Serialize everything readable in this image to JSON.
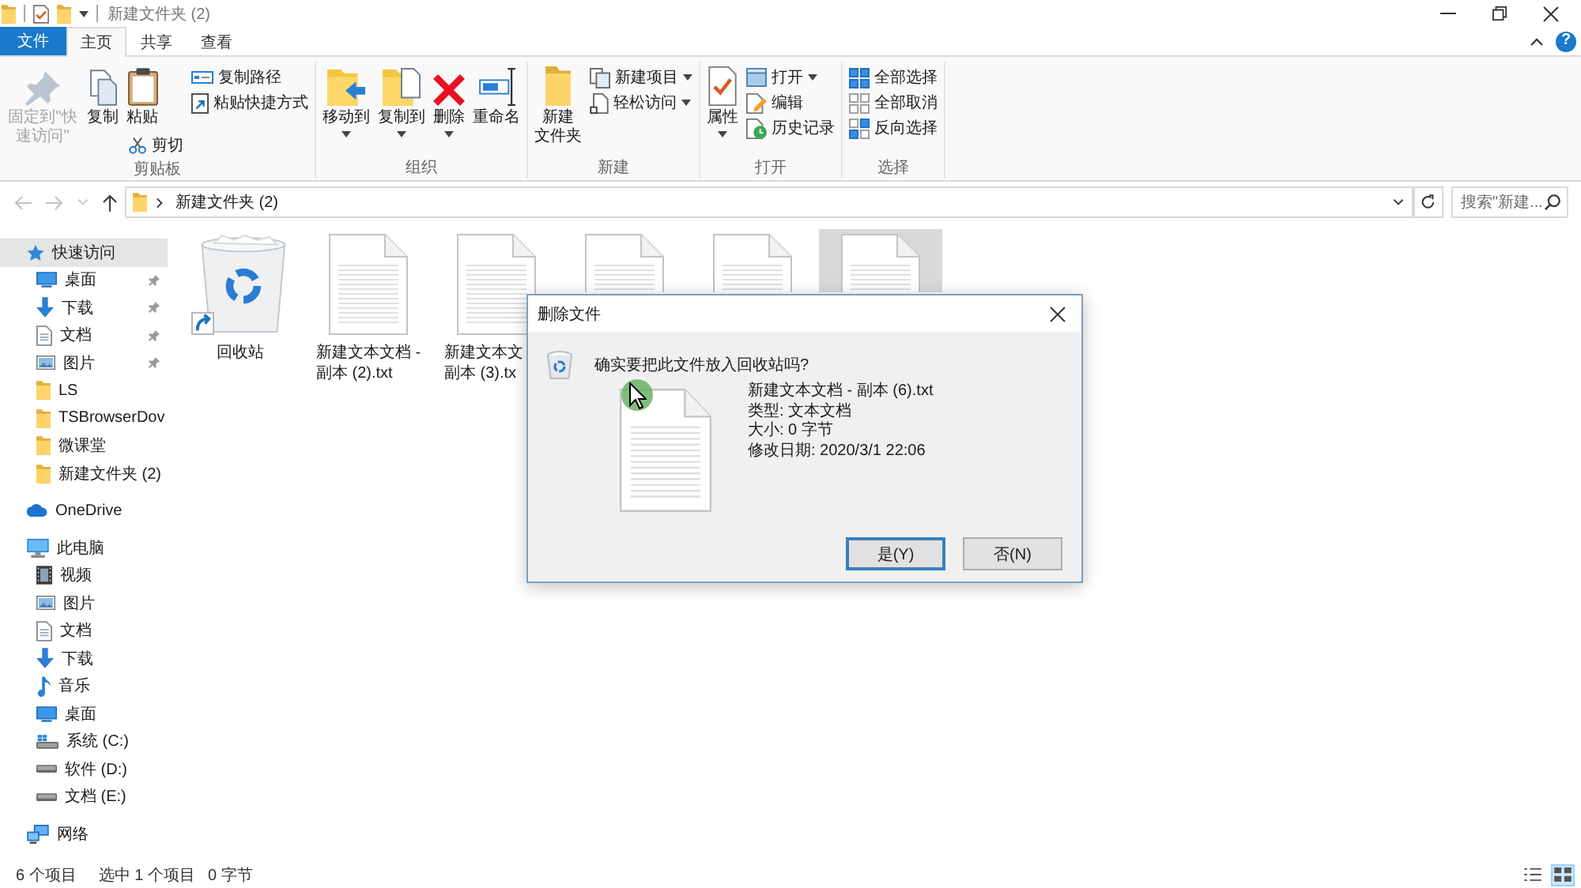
{
  "title_bar": {
    "title": "新建文件夹 (2)"
  },
  "tabs": [
    {
      "label": "文件",
      "kind": "menu",
      "selected": false
    },
    {
      "label": "主页",
      "kind": "tab",
      "selected": true
    },
    {
      "label": "共享",
      "kind": "tab",
      "selected": false
    },
    {
      "label": "查看",
      "kind": "tab",
      "selected": false
    }
  ],
  "help_button": "?",
  "ribbon": {
    "groups": [
      {
        "label": "剪贴板",
        "columns": [
          {
            "items": [
              {
                "kind": "large",
                "label": "固定到\"快速访问\"",
                "dropdown": false,
                "disabled": true
              }
            ]
          },
          {
            "items": [
              {
                "kind": "large",
                "label": "复制",
                "dropdown": false,
                "disabled": false
              }
            ]
          },
          {
            "items": [
              {
                "kind": "large",
                "label": "粘贴",
                "dropdown": false,
                "disabled": false
              },
              {
                "kind": "small",
                "label": "剪切",
                "dropdown": false,
                "disabled": false
              }
            ]
          },
          {
            "items": [
              {
                "kind": "small",
                "label": "复制路径",
                "dropdown": false,
                "disabled": false
              },
              {
                "kind": "small",
                "label": "粘贴快捷方式",
                "dropdown": false,
                "disabled": false
              }
            ]
          }
        ]
      },
      {
        "label": "组织",
        "columns": [
          {
            "items": [
              {
                "kind": "large",
                "label": "移动到",
                "dropdown": true,
                "disabled": false
              }
            ]
          },
          {
            "items": [
              {
                "kind": "large",
                "label": "复制到",
                "dropdown": true,
                "disabled": false
              }
            ]
          },
          {
            "items": [
              {
                "kind": "large",
                "label": "删除",
                "dropdown": true,
                "disabled": false
              }
            ]
          },
          {
            "items": [
              {
                "kind": "large",
                "label": "重命名",
                "dropdown": false,
                "disabled": false
              }
            ]
          }
        ]
      },
      {
        "label": "新建",
        "columns": [
          {
            "items": [
              {
                "kind": "large",
                "label_lines": [
                  "新建",
                  "文件夹"
                ],
                "dropdown": false,
                "disabled": false
              }
            ]
          },
          {
            "items": [
              {
                "kind": "small",
                "label": "新建项目",
                "dropdown": true,
                "disabled": false
              },
              {
                "kind": "small",
                "label": "轻松访问",
                "dropdown": true,
                "disabled": false
              }
            ]
          }
        ]
      },
      {
        "label": "打开",
        "columns": [
          {
            "items": [
              {
                "kind": "large",
                "label": "属性",
                "dropdown": true,
                "disabled": false
              }
            ]
          },
          {
            "items": [
              {
                "kind": "small",
                "label": "打开",
                "dropdown": true,
                "disabled": false
              },
              {
                "kind": "small",
                "label": "编辑",
                "dropdown": false,
                "disabled": false
              },
              {
                "kind": "small",
                "label": "历史记录",
                "dropdown": false,
                "disabled": false
              }
            ]
          }
        ]
      },
      {
        "label": "选择",
        "columns": [
          {
            "items": [
              {
                "kind": "small",
                "label": "全部选择",
                "dropdown": false,
                "disabled": false
              },
              {
                "kind": "small",
                "label": "全部取消",
                "dropdown": false,
                "disabled": false
              },
              {
                "kind": "small",
                "label": "反向选择",
                "dropdown": false,
                "disabled": false
              }
            ]
          }
        ]
      }
    ]
  },
  "navigation": {
    "buttons": [
      {
        "disabled": true
      },
      {
        "disabled": true
      },
      {
        "disabled": true
      },
      {
        "disabled": false
      }
    ],
    "path": [
      "新建文件夹 (2)"
    ],
    "search": {
      "placeholder": "搜索\"新建..."
    }
  },
  "sidebar": {
    "items": [
      {
        "label": "快速访问",
        "selected": true,
        "children": [
          {
            "label": "桌面",
            "pinned": true,
            "selected": false
          },
          {
            "label": "下载",
            "pinned": true,
            "selected": false
          },
          {
            "label": "文档",
            "pinned": true,
            "selected": false
          },
          {
            "label": "图片",
            "pinned": true,
            "selected": false
          },
          {
            "label": "LS",
            "pinned": false,
            "selected": false
          },
          {
            "label": "TSBrowserDov",
            "pinned": false,
            "selected": false
          },
          {
            "label": "微课堂",
            "pinned": false,
            "selected": false
          },
          {
            "label": "新建文件夹 (2)",
            "pinned": false,
            "selected": false
          }
        ]
      },
      {
        "label": "OneDrive",
        "selected": false
      },
      {
        "label": "此电脑",
        "selected": false,
        "children": [
          {
            "label": "视频",
            "selected": false
          },
          {
            "label": "图片",
            "selected": false
          },
          {
            "label": "文档",
            "selected": false
          },
          {
            "label": "下载",
            "selected": false
          },
          {
            "label": "音乐",
            "selected": false
          },
          {
            "label": "桌面",
            "selected": false
          },
          {
            "label": "系统 (C:)",
            "selected": false
          },
          {
            "label": "软件 (D:)",
            "selected": false
          },
          {
            "label": "文档 (E:)",
            "selected": false
          }
        ]
      },
      {
        "label": "网络",
        "selected": false
      }
    ]
  },
  "files": [
    {
      "kind": "bin",
      "label_lines": [
        "回收站"
      ],
      "selected": false
    },
    {
      "kind": "file",
      "label_lines": [
        "新建文本文档 -",
        "副本 (2).txt"
      ],
      "selected": false
    },
    {
      "kind": "file",
      "label_lines": [
        "新建文本文",
        "副本 (3).tx"
      ],
      "selected": false
    },
    {
      "kind": "file",
      "selected": false
    },
    {
      "kind": "file",
      "selected": false
    },
    {
      "kind": "file",
      "selected": true
    }
  ],
  "dialog": {
    "title": "删除文件",
    "question": "确实要把此文件放入回收站吗?",
    "file_name": "新建文本文档 - 副本 (6).txt",
    "details": [
      "类型: 文本文档",
      "大小: 0 字节",
      "修改日期: 2020/3/1 22:06"
    ],
    "buttons": [
      {
        "label": "是(Y)",
        "focused": true
      },
      {
        "label": "否(N)",
        "focused": false
      }
    ]
  },
  "status_bar": {
    "item_count": "6 个项目",
    "selection": "选中 1 个项目",
    "size": "0 字节",
    "views": [
      {
        "selected": false
      },
      {
        "selected": true
      }
    ]
  }
}
